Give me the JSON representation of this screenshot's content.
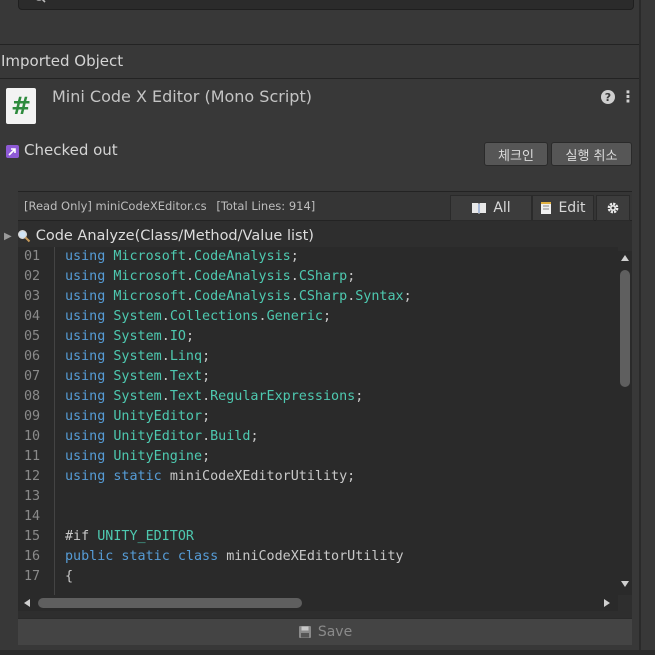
{
  "header": {
    "section_title": "Imported Object"
  },
  "asset": {
    "icon_glyph": "#",
    "icon_name": "csharp-script-icon",
    "title": "Mini Code X Editor (Mono Script)",
    "help_glyph": "?",
    "menu_glyph": "⋮"
  },
  "vcs": {
    "status_text": "Checked out",
    "checkin_label": "체크인",
    "undo_label": "실행 취소"
  },
  "editor": {
    "file_info": "[Read Only] miniCodeXEditor.cs",
    "total_lines": "[Total Lines: 914]",
    "all_label": "All",
    "edit_label": "Edit",
    "analyze_label": "Code Analyze(Class/Method/Value list)",
    "save_label": "Save",
    "lines": [
      {
        "n": "01",
        "t": [
          [
            "kw",
            "using "
          ],
          [
            "ns",
            "Microsoft"
          ],
          [
            "pp",
            "."
          ],
          [
            "ns",
            "CodeAnalysis"
          ],
          [
            "pp",
            ";"
          ]
        ]
      },
      {
        "n": "02",
        "t": [
          [
            "kw",
            "using "
          ],
          [
            "ns",
            "Microsoft"
          ],
          [
            "pp",
            "."
          ],
          [
            "ns",
            "CodeAnalysis"
          ],
          [
            "pp",
            "."
          ],
          [
            "ns",
            "CSharp"
          ],
          [
            "pp",
            ";"
          ]
        ]
      },
      {
        "n": "03",
        "t": [
          [
            "kw",
            "using "
          ],
          [
            "ns",
            "Microsoft"
          ],
          [
            "pp",
            "."
          ],
          [
            "ns",
            "CodeAnalysis"
          ],
          [
            "pp",
            "."
          ],
          [
            "ns",
            "CSharp"
          ],
          [
            "pp",
            "."
          ],
          [
            "ns",
            "Syntax"
          ],
          [
            "pp",
            ";"
          ]
        ]
      },
      {
        "n": "04",
        "t": [
          [
            "kw",
            "using "
          ],
          [
            "ns",
            "System"
          ],
          [
            "pp",
            "."
          ],
          [
            "ns",
            "Collections"
          ],
          [
            "pp",
            "."
          ],
          [
            "ns",
            "Generic"
          ],
          [
            "pp",
            ";"
          ]
        ]
      },
      {
        "n": "05",
        "t": [
          [
            "kw",
            "using "
          ],
          [
            "ns",
            "System"
          ],
          [
            "pp",
            "."
          ],
          [
            "ns",
            "IO"
          ],
          [
            "pp",
            ";"
          ]
        ]
      },
      {
        "n": "06",
        "t": [
          [
            "kw",
            "using "
          ],
          [
            "ns",
            "System"
          ],
          [
            "pp",
            "."
          ],
          [
            "ns",
            "Linq"
          ],
          [
            "pp",
            ";"
          ]
        ]
      },
      {
        "n": "07",
        "t": [
          [
            "kw",
            "using "
          ],
          [
            "ns",
            "System"
          ],
          [
            "pp",
            "."
          ],
          [
            "ns",
            "Text"
          ],
          [
            "pp",
            ";"
          ]
        ]
      },
      {
        "n": "08",
        "t": [
          [
            "kw",
            "using "
          ],
          [
            "ns",
            "System"
          ],
          [
            "pp",
            "."
          ],
          [
            "ns",
            "Text"
          ],
          [
            "pp",
            "."
          ],
          [
            "ns",
            "RegularExpressions"
          ],
          [
            "pp",
            ";"
          ]
        ]
      },
      {
        "n": "09",
        "t": [
          [
            "kw",
            "using "
          ],
          [
            "ns",
            "UnityEditor"
          ],
          [
            "pp",
            ";"
          ]
        ]
      },
      {
        "n": "10",
        "t": [
          [
            "kw",
            "using "
          ],
          [
            "ns",
            "UnityEditor"
          ],
          [
            "pp",
            "."
          ],
          [
            "ns",
            "Build"
          ],
          [
            "pp",
            ";"
          ]
        ]
      },
      {
        "n": "11",
        "t": [
          [
            "kw",
            "using "
          ],
          [
            "ns",
            "UnityEngine"
          ],
          [
            "pp",
            ";"
          ]
        ]
      },
      {
        "n": "12",
        "t": [
          [
            "kw",
            "using static "
          ],
          [
            "pp",
            "miniCodeXEditorUtility;"
          ]
        ]
      },
      {
        "n": "13",
        "t": []
      },
      {
        "n": "14",
        "t": []
      },
      {
        "n": "15",
        "t": [
          [
            "pp",
            "#if "
          ],
          [
            "ns",
            "UNITY_EDITOR"
          ]
        ]
      },
      {
        "n": "16",
        "t": [
          [
            "kw",
            "public static class "
          ],
          [
            "pp",
            "miniCodeXEditorUtility"
          ]
        ]
      },
      {
        "n": "17",
        "t": [
          [
            "pp",
            "{"
          ]
        ]
      }
    ]
  },
  "colors": {
    "background": "#383838",
    "code_bg": "#2a2a2a",
    "keyword": "#569cd6",
    "type": "#4ec9b0",
    "status_icon": "#8e5ad6",
    "script_icon": "#2e8b3e"
  }
}
